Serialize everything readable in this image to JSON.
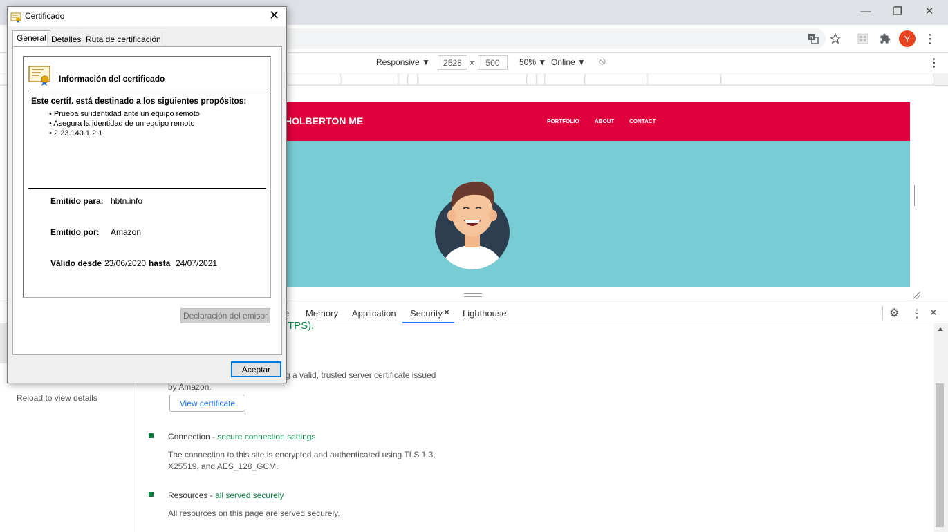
{
  "browser": {
    "window_controls": {
      "minimize": "—",
      "restore": "❐",
      "close": "✕"
    },
    "toolbar_icons": [
      "translate-icon",
      "star-icon",
      "extension-grid-icon",
      "puzzle-icon"
    ],
    "profile_initial": "Y",
    "menu_glyph": "⋮"
  },
  "device_toolbar": {
    "mode": "Responsive ▼",
    "width": "2528",
    "times": "×",
    "height": "500",
    "zoom": "50% ▼",
    "throttle": "Online ▼",
    "rotate_glyph": "⦸",
    "menu_glyph": "⋮"
  },
  "site": {
    "brand": "HOLBERTON ME",
    "nav": [
      "PORTFOLIO",
      "ABOUT",
      "CONTACT"
    ],
    "colors": {
      "nav": "#e0003c",
      "hero": "#78cdd5"
    }
  },
  "devtools": {
    "tabs": [
      "e",
      "Memory",
      "Application",
      "Security",
      "Lighthouse"
    ],
    "active_tab": "Security",
    "close_tab_glyph": "✕",
    "icons": {
      "settings": "⚙",
      "more": "⋮",
      "close": "✕"
    },
    "left_panel": {
      "reload_hint": "Reload to view details"
    },
    "main": {
      "https_fragment": "TPS).",
      "certificate_desc_line1": "g a valid, trusted server certificate issued",
      "certificate_desc_line2": "by Amazon.",
      "view_certificate": "View certificate",
      "connection_title": "Connection - ",
      "connection_status": "secure connection settings",
      "connection_desc_line1": "The connection to this site is encrypted and authenticated using TLS 1.3,",
      "connection_desc_line2": "X25519, and AES_128_GCM.",
      "resources_title": "Resources - ",
      "resources_status": "all served securely",
      "resources_desc": "All resources on this page are served securely."
    }
  },
  "dialog": {
    "title": "Certificado",
    "close_glyph": "✕",
    "tabs": [
      "General",
      "Detalles",
      "Ruta de certificación"
    ],
    "heading": "Información del certificado",
    "purpose_title": "Este certif. está destinado a los siguientes propósitos:",
    "purposes": [
      "• Prueba su identidad ante un equipo remoto",
      "• Asegura la identidad de un equipo remoto",
      "• 2.23.140.1.2.1"
    ],
    "issued_to_label": "Emitido para:",
    "issued_to": "hbtn.info",
    "issued_by_label": "Emitido por:",
    "issued_by": "Amazon",
    "valid_from_label": "Válido desde",
    "valid_from": "23/06/2020",
    "valid_to_label": "hasta",
    "valid_to": "24/07/2021",
    "issuer_statement": "Declaración del emisor",
    "accept": "Aceptar"
  }
}
